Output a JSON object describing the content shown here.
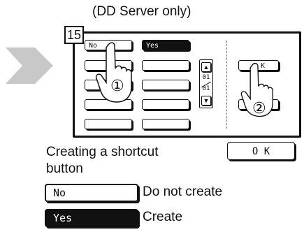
{
  "caption": "(DD Server only)",
  "step_number": "15",
  "panel": {
    "no_label": "No",
    "yes_label": "Yes",
    "ok_label": "O K",
    "page_current": "01",
    "page_total": "01",
    "callout_1": "①",
    "callout_2": "②"
  },
  "shortcut": {
    "label": "Creating a shortcut button",
    "ok_label": "O K"
  },
  "legend": [
    {
      "button": "No",
      "description": "Do not create"
    },
    {
      "button": "Yes",
      "description": "Create"
    }
  ]
}
